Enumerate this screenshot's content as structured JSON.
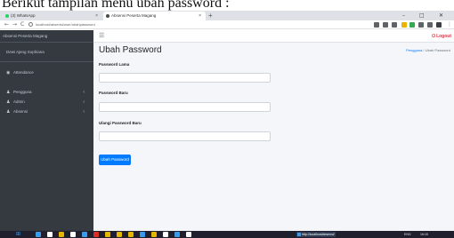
{
  "caption": "Berikut tampilan menu ubah password :",
  "browser": {
    "tabs": [
      {
        "title": "(3) WhatsApp",
        "icon": "whatsapp-icon",
        "color": "#25d366"
      },
      {
        "title": "Absensi Peserta Magang",
        "icon": "globe-icon",
        "color": "#4a4a4a"
      }
    ],
    "new_tab": "+",
    "window_controls": {
      "minimize": "–",
      "maximize": "□",
      "close": "✕"
    },
    "nav": {
      "back": "←",
      "forward": "→",
      "reload": "C"
    },
    "url": "localhost/absensi/user/ubahpassword",
    "extension_colors": [
      "#5f6368",
      "#5f6368",
      "#5f6368",
      "#e8b400",
      "#34a853",
      "#5f6368",
      "#5f6368",
      "#3c4043"
    ]
  },
  "sidebar": {
    "brand": "Absensi Peserta Magang",
    "user_name": "Dewi Ajeng Sophiana",
    "items": [
      {
        "label": "Attendance",
        "icon": "dashboard-icon",
        "has_chevron": false
      },
      {
        "label": "Pengguna",
        "icon": "users-icon",
        "has_chevron": true
      },
      {
        "label": "Admin",
        "icon": "users-icon",
        "has_chevron": true
      },
      {
        "label": "Absensi",
        "icon": "users-icon",
        "has_chevron": true
      }
    ],
    "chevron": "‹"
  },
  "topnav": {
    "menu_icon": "☰",
    "logout_label": "Logout",
    "logout_icon": "⏻"
  },
  "main": {
    "title": "Ubah Password",
    "breadcrumb": {
      "parent": "Pengguna",
      "separator": "/",
      "current": "Ubah Password"
    },
    "fields": [
      {
        "label": "Password Lama",
        "value": ""
      },
      {
        "label": "Password Baru",
        "value": ""
      },
      {
        "label": "Ulangi Password Baru",
        "value": ""
      }
    ],
    "submit_label": "Ubah Password"
  },
  "taskbar": {
    "start_icon": "⊞",
    "app_colors": [
      "#3c9be8",
      "#ffffff",
      "#e8b400",
      "#ffffff",
      "#3c9be8",
      "#d93025",
      "#e8b400",
      "#e8b400",
      "#e8b400",
      "#3c9be8",
      "#e8b400",
      "#ffffff",
      "#3c9be8",
      "#ffffff"
    ],
    "active_window": "http://localhost/absensi/",
    "tray_lang": "ENG",
    "clock": "16:18"
  }
}
